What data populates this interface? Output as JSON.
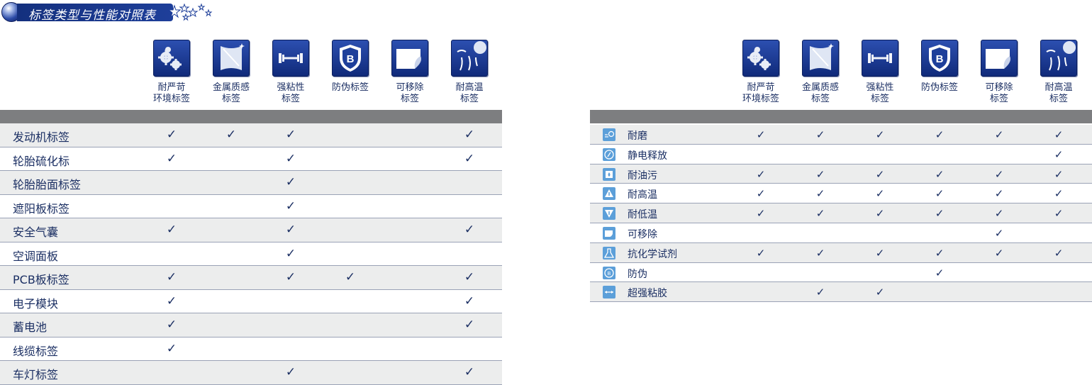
{
  "title": "标签类型与性能对照表",
  "colors": {
    "navy": "#14307e",
    "band": "#7d7e80",
    "alt_row": "#eceded",
    "icon_blue": "#5c9fd9"
  },
  "left_table": {
    "columns": [
      {
        "icon": "gears-icon",
        "label": "耐严苛\n环境标签"
      },
      {
        "icon": "metal-sheet-icon",
        "label": "金属质感\n标签"
      },
      {
        "icon": "dumbbell-icon",
        "label": "强粘性\n标签"
      },
      {
        "icon": "shield-b-icon",
        "label": "防伪标签"
      },
      {
        "icon": "peel-label-icon",
        "label": "可移除\n标签"
      },
      {
        "icon": "sun-heat-icon",
        "label": "耐高温\n标签"
      }
    ],
    "rows": [
      {
        "label": "发动机标签",
        "checks": [
          true,
          true,
          true,
          false,
          false,
          true
        ]
      },
      {
        "label": "轮胎硫化标",
        "checks": [
          true,
          false,
          true,
          false,
          false,
          true
        ]
      },
      {
        "label": "轮胎胎面标签",
        "checks": [
          false,
          false,
          true,
          false,
          false,
          false
        ]
      },
      {
        "label": "遮阳板标签",
        "checks": [
          false,
          false,
          true,
          false,
          false,
          false
        ]
      },
      {
        "label": "安全气囊",
        "checks": [
          true,
          false,
          true,
          false,
          false,
          true
        ]
      },
      {
        "label": "空调面板",
        "checks": [
          false,
          false,
          true,
          false,
          false,
          false
        ]
      },
      {
        "label": "PCB板标签",
        "checks": [
          true,
          false,
          true,
          true,
          false,
          true
        ]
      },
      {
        "label": "电子模块",
        "checks": [
          true,
          false,
          false,
          false,
          false,
          true
        ]
      },
      {
        "label": "蓄电池",
        "checks": [
          true,
          false,
          false,
          false,
          false,
          true
        ]
      },
      {
        "label": "线缆标签",
        "checks": [
          true,
          false,
          false,
          false,
          false,
          false
        ]
      },
      {
        "label": "车灯标签",
        "checks": [
          false,
          false,
          true,
          false,
          false,
          true
        ]
      }
    ]
  },
  "right_table": {
    "columns": [
      {
        "icon": "gears-icon",
        "label": "耐严苛\n环境标签"
      },
      {
        "icon": "metal-sheet-icon",
        "label": "金属质感\n标签"
      },
      {
        "icon": "dumbbell-icon",
        "label": "强粘性\n标签"
      },
      {
        "icon": "shield-b-icon",
        "label": "防伪标签"
      },
      {
        "icon": "peel-label-icon",
        "label": "可移除\n标签"
      },
      {
        "icon": "sun-heat-icon",
        "label": "耐高温\n标签"
      }
    ],
    "rows": [
      {
        "icon": "abrasion-icon",
        "label": "耐磨",
        "checks": [
          true,
          true,
          true,
          true,
          true,
          true
        ]
      },
      {
        "icon": "static-icon",
        "label": "静电释放",
        "checks": [
          false,
          false,
          false,
          false,
          false,
          true
        ]
      },
      {
        "icon": "oil-icon",
        "label": "耐油污",
        "checks": [
          true,
          true,
          true,
          true,
          true,
          true
        ]
      },
      {
        "icon": "high-temp-icon",
        "label": "耐高温",
        "checks": [
          true,
          true,
          true,
          true,
          true,
          true
        ]
      },
      {
        "icon": "low-temp-icon",
        "label": "耐低温",
        "checks": [
          true,
          true,
          true,
          true,
          true,
          true
        ]
      },
      {
        "icon": "removable-icon",
        "label": "可移除",
        "checks": [
          false,
          false,
          false,
          false,
          true,
          false
        ]
      },
      {
        "icon": "chemical-icon",
        "label": "抗化学试剂",
        "checks": [
          true,
          true,
          true,
          true,
          true,
          true
        ]
      },
      {
        "icon": "anti-counterfeit-icon",
        "label": "防伪",
        "checks": [
          false,
          false,
          false,
          true,
          false,
          false
        ]
      },
      {
        "icon": "strong-adhesive-icon",
        "label": "超强粘胶",
        "checks": [
          false,
          true,
          true,
          false,
          false,
          false
        ]
      }
    ]
  },
  "check_mark": "✓"
}
